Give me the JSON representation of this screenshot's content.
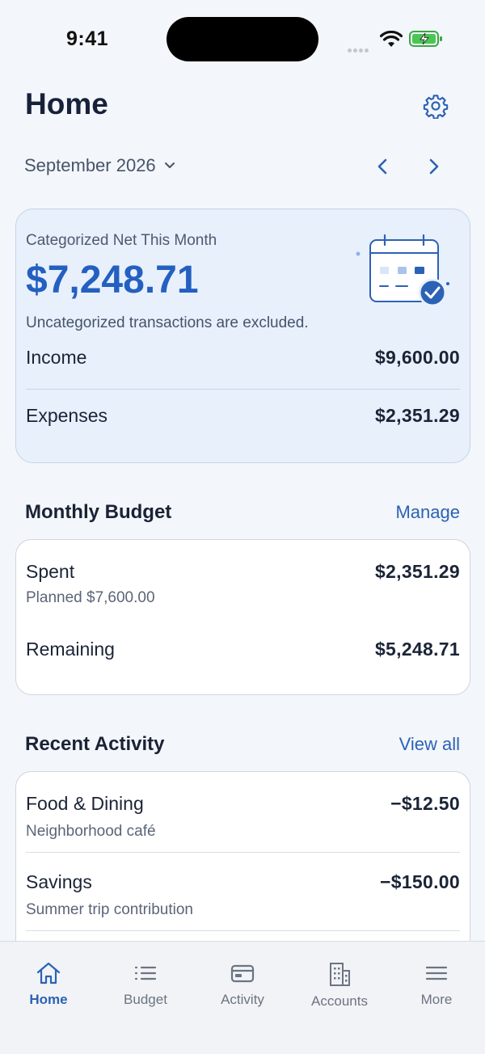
{
  "status_bar": {
    "time": "9:41"
  },
  "header": {
    "title": "Home"
  },
  "month": {
    "label": "September 2026"
  },
  "net_card": {
    "label": "Categorized Net This Month",
    "amount": "$7,248.71",
    "note": "Uncategorized transactions are excluded.",
    "income_label": "Income",
    "income_amount": "$9,600.00",
    "expenses_label": "Expenses",
    "expenses_amount": "$2,351.29"
  },
  "budget": {
    "title": "Monthly Budget",
    "action": "Manage",
    "spent_label": "Spent",
    "spent_amount": "$2,351.29",
    "planned": "Planned $7,600.00",
    "remaining_label": "Remaining",
    "remaining_amount": "$5,248.71"
  },
  "activity": {
    "title": "Recent Activity",
    "action": "View all",
    "items": [
      {
        "category": "Food & Dining",
        "description": "Neighborhood café",
        "amount": "−$12.50"
      },
      {
        "category": "Savings",
        "description": "Summer trip contribution",
        "amount": "−$150.00"
      }
    ]
  },
  "tabs": [
    {
      "label": "Home",
      "icon": "home-icon",
      "active": true
    },
    {
      "label": "Budget",
      "icon": "list-icon",
      "active": false
    },
    {
      "label": "Activity",
      "icon": "card-icon",
      "active": false
    },
    {
      "label": "Accounts",
      "icon": "building-icon",
      "active": false
    },
    {
      "label": "More",
      "icon": "menu-icon",
      "active": false
    }
  ],
  "colors": {
    "accent": "#2c62b5",
    "net_amount": "#2460c0",
    "card_tint": "#e8f0fc",
    "background": "#f3f6fa"
  }
}
